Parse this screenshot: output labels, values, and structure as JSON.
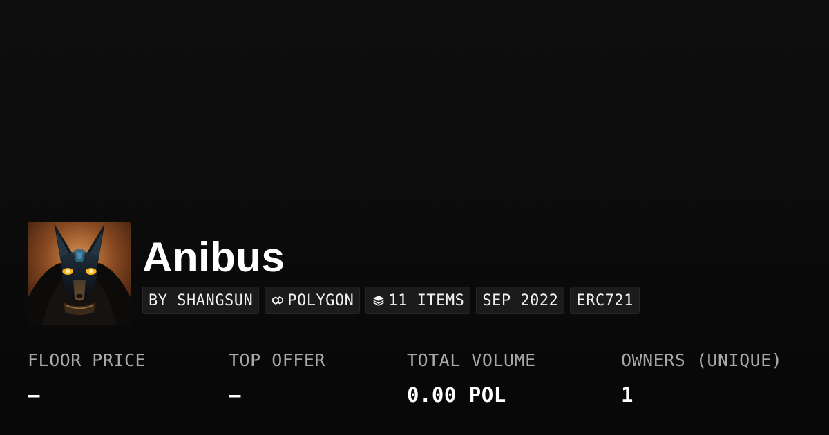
{
  "collection": {
    "name": "Anibus"
  },
  "pills": {
    "creator": "BY SHANGSUN",
    "chain": "POLYGON",
    "chain_icon": "polygon-chain-icon",
    "items": "11 ITEMS",
    "items_icon": "layers-icon",
    "date": "SEP 2022",
    "standard": "ERC721"
  },
  "stats": {
    "floor_price": {
      "label": "FLOOR PRICE",
      "value": "–"
    },
    "top_offer": {
      "label": "TOP OFFER",
      "value": "–"
    },
    "total_volume": {
      "label": "TOTAL VOLUME",
      "value": "0.00 POL"
    },
    "owners": {
      "label": "OWNERS (UNIQUE)",
      "value": "1"
    }
  },
  "colors": {
    "background": "#0b0b0b",
    "pill_background": "#1b1b1b",
    "label_gray": "#a8a8a8",
    "text_white": "#ffffff"
  }
}
